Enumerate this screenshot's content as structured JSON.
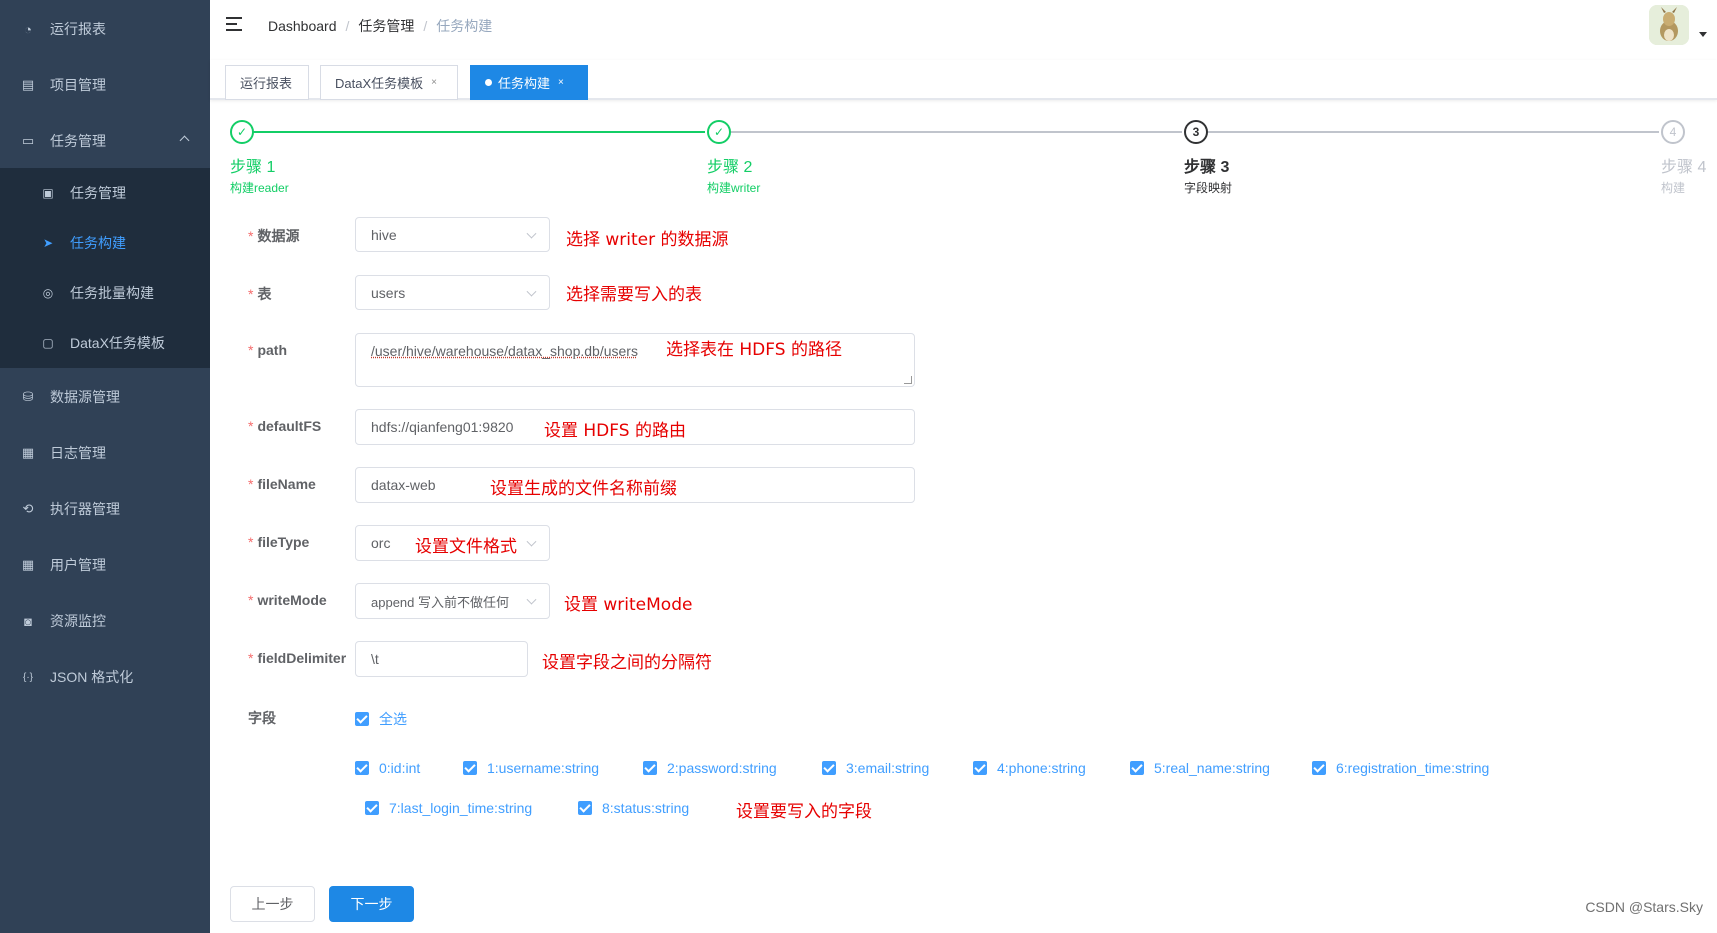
{
  "sidebar": {
    "items": [
      {
        "label": "运行报表",
        "icon": "dashboard-icon",
        "glyph": "◔"
      },
      {
        "label": "项目管理",
        "icon": "database-icon",
        "glyph": "▤"
      },
      {
        "label": "任务管理",
        "icon": "monitor-icon",
        "glyph": "▭"
      },
      {
        "label": "数据源管理",
        "icon": "datasource-icon",
        "glyph": "⛁"
      },
      {
        "label": "日志管理",
        "icon": "log-icon",
        "glyph": "▦"
      },
      {
        "label": "执行器管理",
        "icon": "executor-icon",
        "glyph": "⟲"
      },
      {
        "label": "用户管理",
        "icon": "table-icon",
        "glyph": "▦"
      },
      {
        "label": "资源监控",
        "icon": "monitor-eye-icon",
        "glyph": "◙"
      },
      {
        "label": "JSON 格式化",
        "icon": "json-icon",
        "glyph": "{·}"
      }
    ],
    "submenu": [
      {
        "label": "任务管理",
        "icon": "task-icon",
        "glyph": "▣"
      },
      {
        "label": "任务构建",
        "icon": "send-icon",
        "glyph": "➤"
      },
      {
        "label": "任务批量构建",
        "icon": "batch-icon",
        "glyph": "◎"
      },
      {
        "label": "DataX任务模板",
        "icon": "template-icon",
        "glyph": "▢"
      }
    ]
  },
  "navbar": {
    "breadcrumb": [
      "Dashboard",
      "任务管理",
      "任务构建"
    ],
    "separator": "/"
  },
  "tags": [
    {
      "label": "运行报表",
      "close": ""
    },
    {
      "label": "DataX任务模板",
      "close": "×"
    },
    {
      "label": "任务构建",
      "close": "×"
    }
  ],
  "steps": [
    {
      "num": "✓",
      "title": "步骤 1",
      "desc": "构建reader"
    },
    {
      "num": "✓",
      "title": "步骤 2",
      "desc": "构建writer"
    },
    {
      "num": "3",
      "title": "步骤 3",
      "desc": "字段映射"
    },
    {
      "num": "4",
      "title": "步骤 4",
      "desc": "构建"
    }
  ],
  "form": {
    "required_mark": "*",
    "datasource": {
      "label": "数据源",
      "value": "hive",
      "note": "选择 writer 的数据源"
    },
    "table": {
      "label": "表",
      "value": "users",
      "note": "选择需要写入的表"
    },
    "path": {
      "label": "path",
      "value": "/user/hive/warehouse/datax_shop.db/users",
      "note": "选择表在 HDFS 的路径"
    },
    "defaultFS": {
      "label": "defaultFS",
      "value": "hdfs://qianfeng01:9820",
      "note": "设置 HDFS 的路由"
    },
    "fileName": {
      "label": "fileName",
      "value": "datax-web",
      "note": "设置生成的文件名称前缀"
    },
    "fileType": {
      "label": "fileType",
      "value": "orc",
      "note": "设置文件格式"
    },
    "writeMode": {
      "label": "writeMode",
      "value": "append 写入前不做任何",
      "note": "设置 writeMode"
    },
    "fieldDelimiter": {
      "label": "fieldDelimiter",
      "value": "\\t",
      "note": "设置字段之间的分隔符"
    },
    "fields": {
      "label": "字段",
      "select_all": "全选",
      "items": [
        "0:id:int",
        "1:username:string",
        "2:password:string",
        "3:email:string",
        "4:phone:string",
        "5:real_name:string",
        "6:registration_time:string",
        "7:last_login_time:string",
        "8:status:string"
      ],
      "note": "设置要写入的字段"
    }
  },
  "buttons": {
    "prev": "上一步",
    "next": "下一步"
  },
  "watermark": "CSDN @Stars.Sky"
}
